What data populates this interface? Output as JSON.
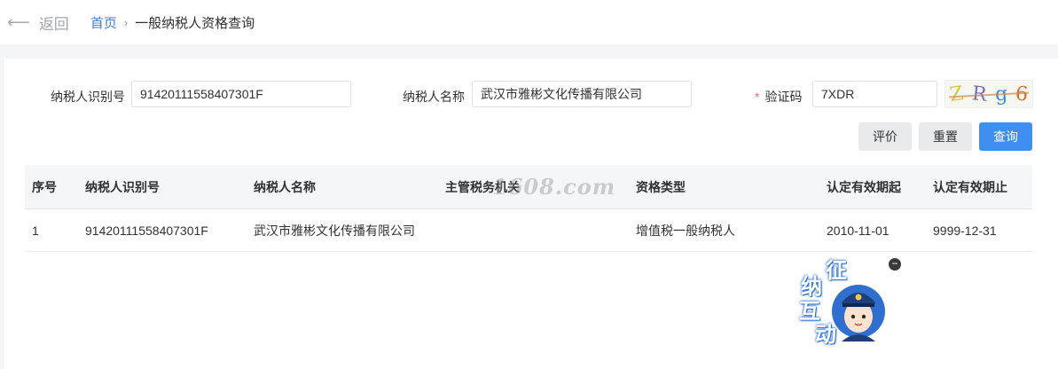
{
  "topbar": {
    "back_label": "返回",
    "breadcrumb_home": "首页",
    "breadcrumb_separator": "›",
    "breadcrumb_current": "一般纳税人资格查询"
  },
  "form": {
    "taxpayer_id_label": "纳税人识别号",
    "taxpayer_id_value": "91420111558407301F",
    "taxpayer_name_label": "纳税人名称",
    "taxpayer_name_value": "武汉市雅彬文化传播有限公司",
    "captcha_required_mark": "*",
    "captcha_label": "验证码",
    "captcha_value": "7XDR",
    "captcha_image_chars": [
      "Z",
      "R",
      "g",
      "6"
    ]
  },
  "buttons": {
    "evaluate": "评价",
    "reset": "重置",
    "query": "查询"
  },
  "table": {
    "columns": [
      "序号",
      "纳税人识别号",
      "纳税人名称",
      "主管税务机关",
      "资格类型",
      "认定有效期起",
      "认定有效期止"
    ],
    "rows": [
      [
        "1",
        "91420111558407301F",
        "武汉市雅彬文化传播有限公司",
        "",
        "增值税一般纳税人",
        "2010-11-01",
        "9999-12-31"
      ]
    ]
  },
  "watermark": "1608.com",
  "widget": {
    "chars": [
      "征",
      "纳",
      "互",
      "动"
    ],
    "close_symbol": "−"
  },
  "colors": {
    "primary": "#3f8ff0",
    "link": "#3b7ed6",
    "required": "#f56c6c"
  }
}
